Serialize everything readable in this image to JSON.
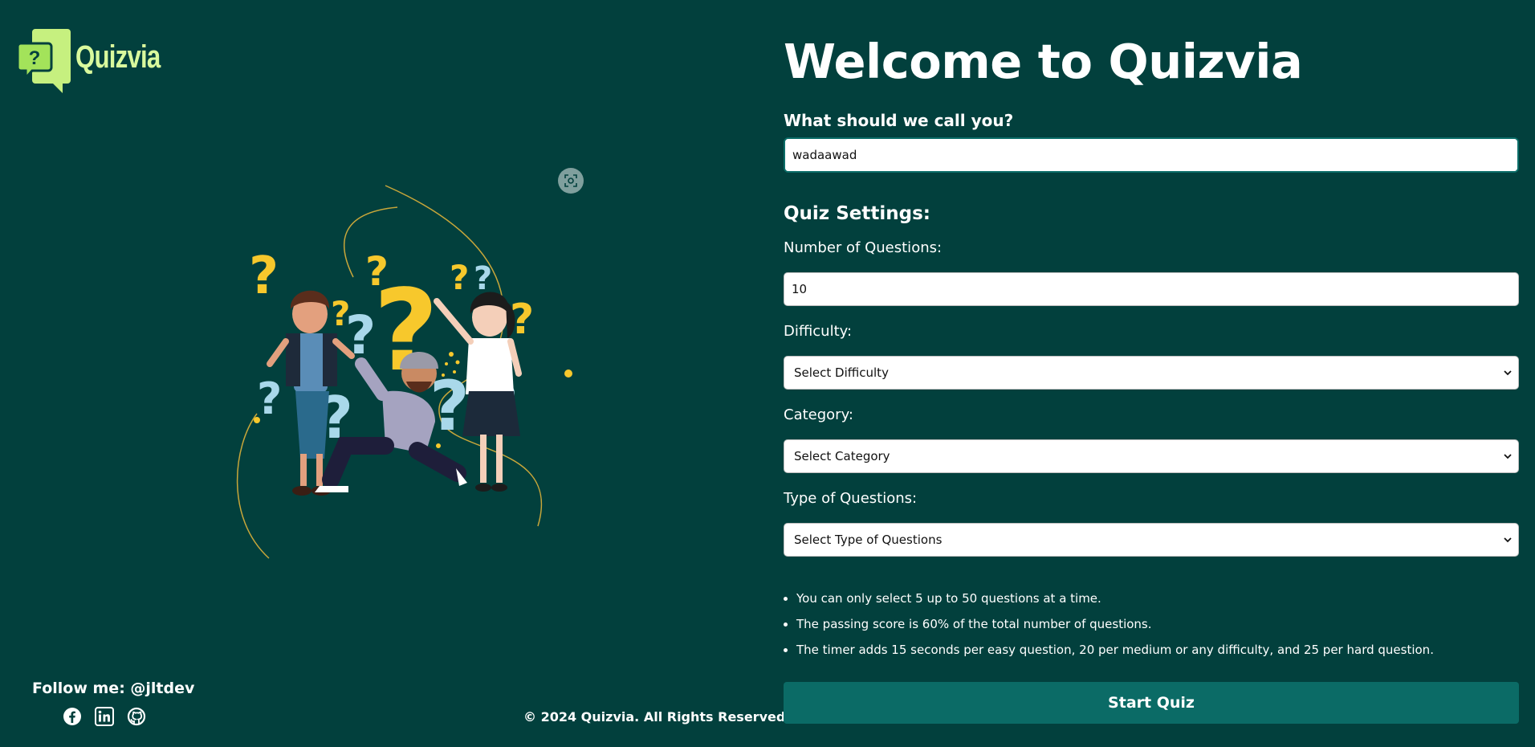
{
  "brand": {
    "name": "Quizvia"
  },
  "welcome_title": "Welcome to Quizvia",
  "name_field": {
    "label": "What should we call you?",
    "value": "wadaawad"
  },
  "settings": {
    "title": "Quiz Settings:",
    "num_questions": {
      "label": "Number of Questions:",
      "value": "10"
    },
    "difficulty": {
      "label": "Difficulty:",
      "selected": "Select Difficulty"
    },
    "category": {
      "label": "Category:",
      "selected": "Select Category"
    },
    "type": {
      "label": "Type of Questions:",
      "selected": "Select Type of Questions"
    }
  },
  "rules": [
    "You can only select 5 up to 50 questions at a time.",
    "The passing score is 60% of the total number of questions.",
    "The timer adds 15 seconds per easy question, 20 per medium or any difficulty, and 25 per hard question."
  ],
  "start_button": "Start Quiz",
  "footer": {
    "follow": "Follow me: @jltdev",
    "social_icons": [
      "facebook-icon",
      "linkedin-icon",
      "github-icon"
    ],
    "copyright": "© 2024 Quizvia. All Rights Reserved."
  },
  "colors": {
    "background": "#02403d",
    "button": "#0b6b66",
    "logo_accent": "#d9f99d",
    "question_yellow": "#f7c82c",
    "question_blue": "#a9d8ea"
  }
}
